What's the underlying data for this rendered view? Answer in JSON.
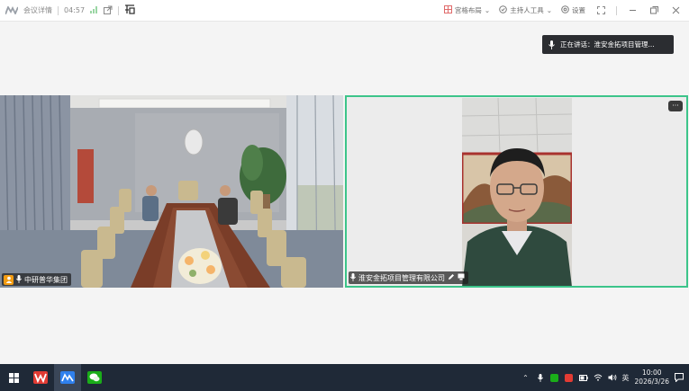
{
  "topbar": {
    "app_name": "会议详情",
    "timer": "04:57",
    "layout_label": "宫格布局",
    "host_tools_label": "主持人工具",
    "settings_label": "设置",
    "icons": [
      "signal-icon",
      "share-icon",
      "translate-icon",
      "layout-icon",
      "shield-icon",
      "gear-icon",
      "fullscreen-icon",
      "minimize-icon",
      "restore-icon",
      "close-icon"
    ]
  },
  "speaking": {
    "text": "正在讲话：淮安金拓项目管理..."
  },
  "tiles": [
    {
      "name": "中研普华集团",
      "host": true
    },
    {
      "name": "淮安金拓项目管理有限公司",
      "active_speaker": true,
      "more_label": "···"
    }
  ],
  "taskbar": {
    "apps": [
      "windows-start",
      "wps-icon",
      "meeting-app-icon",
      "wechat-icon"
    ],
    "ime": "英",
    "time": "10:00",
    "date": "2026/3/26"
  },
  "colors": {
    "accent_green": "#3cc48a",
    "host_orange": "#f39c12",
    "taskbar": "#1f2937"
  }
}
